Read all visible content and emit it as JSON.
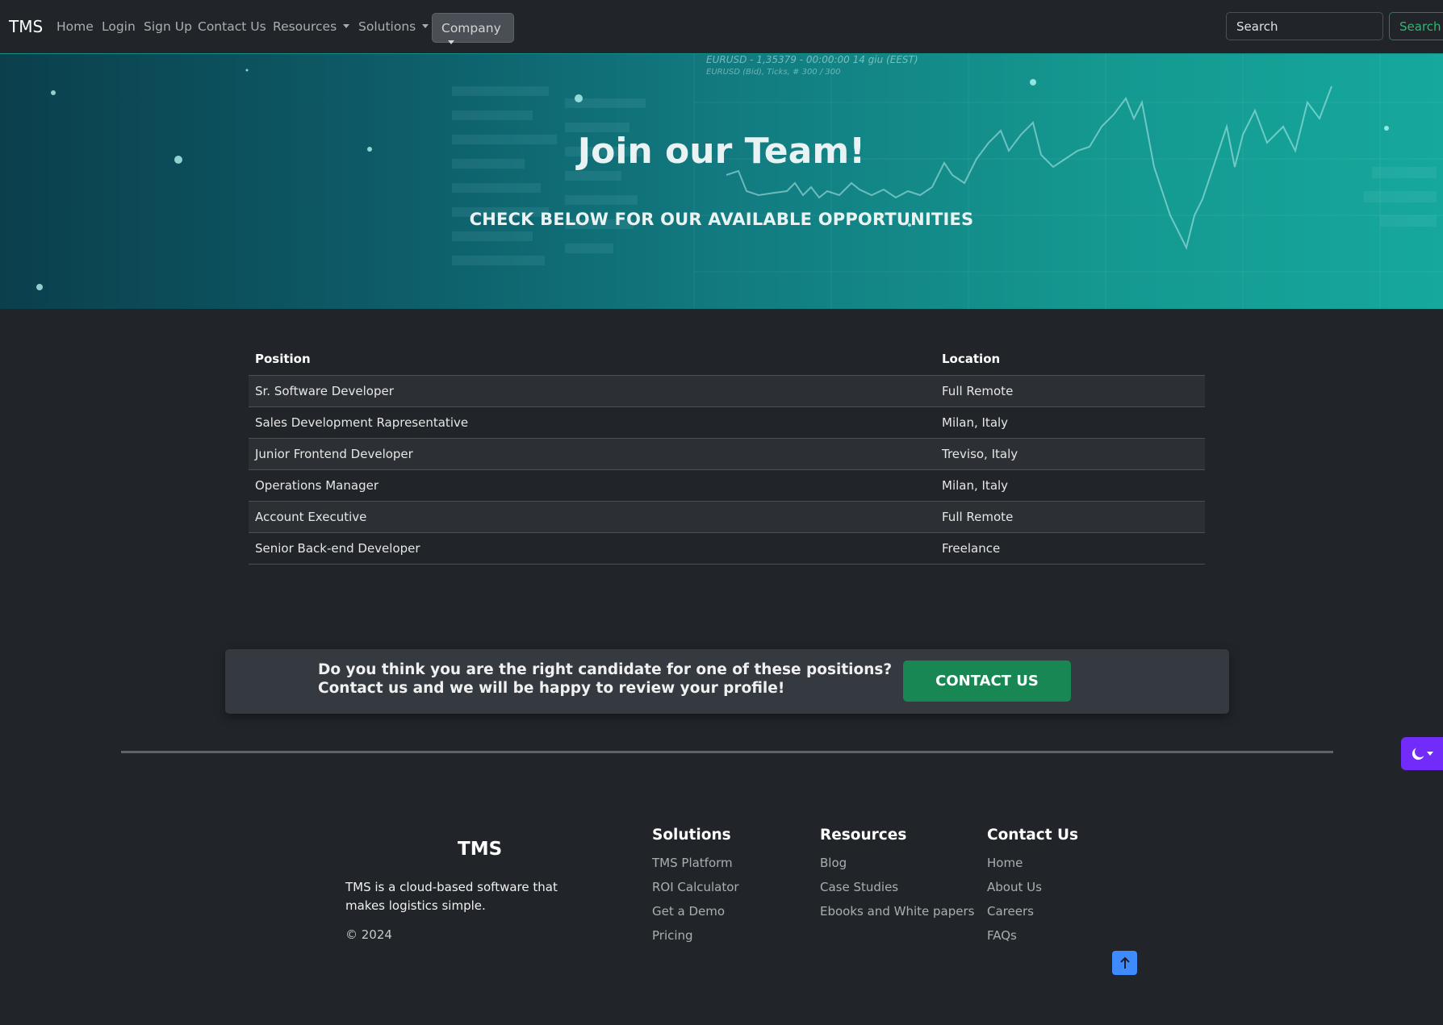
{
  "navbar": {
    "brand": "TMS",
    "links": [
      "Home",
      "Login",
      "Sign Up",
      "Contact Us"
    ],
    "dropdowns": [
      "Resources",
      "Solutions",
      "Company"
    ],
    "search_placeholder": "Search",
    "search_button": "Search"
  },
  "hero": {
    "title": "Join our Team!",
    "subtitle": "CHECK BELOW FOR OUR AVAILABLE OPPORTUNITIES",
    "chart_caption_1": "EURUSD - 1,35379 - 00:00:00  14 giu (EEST)",
    "chart_caption_2": "EURUSD (Bid), Ticks, # 300 / 300"
  },
  "jobs": {
    "headers": [
      "Position",
      "Location"
    ],
    "rows": [
      {
        "position": "Sr. Software Developer",
        "location": "Full Remote"
      },
      {
        "position": "Sales Development Rapresentative",
        "location": "Milan, Italy"
      },
      {
        "position": "Junior Frontend Developer",
        "location": "Treviso, Italy"
      },
      {
        "position": "Operations Manager",
        "location": "Milan, Italy"
      },
      {
        "position": "Account Executive",
        "location": "Full Remote"
      },
      {
        "position": "Senior Back-end Developer",
        "location": "Freelance"
      }
    ]
  },
  "cta": {
    "line1": "Do you think you are the right candidate for one of these positions?",
    "line2": "Contact us and we will be happy to review your profile!",
    "button": "CONTACT US"
  },
  "theme_toggle": {
    "icon": "moon-icon"
  },
  "footer": {
    "brand": "TMS",
    "description": "TMS is a cloud-based software that makes logistics simple.",
    "copyright": "© 2024",
    "columns": [
      {
        "title": "Solutions",
        "links": [
          "TMS Platform",
          "ROI Calculator",
          "Get a Demo",
          "Pricing"
        ]
      },
      {
        "title": "Resources",
        "links": [
          "Blog",
          "Case Studies",
          "Ebooks and White papers"
        ]
      },
      {
        "title": "Contact Us",
        "links": [
          "Home",
          "About Us",
          "Careers",
          "FAQs"
        ]
      }
    ]
  },
  "colors": {
    "background": "#212529",
    "accent_green": "#198754",
    "theme_toggle": "#712cf9",
    "back_to_top": "#3d8bfd"
  }
}
